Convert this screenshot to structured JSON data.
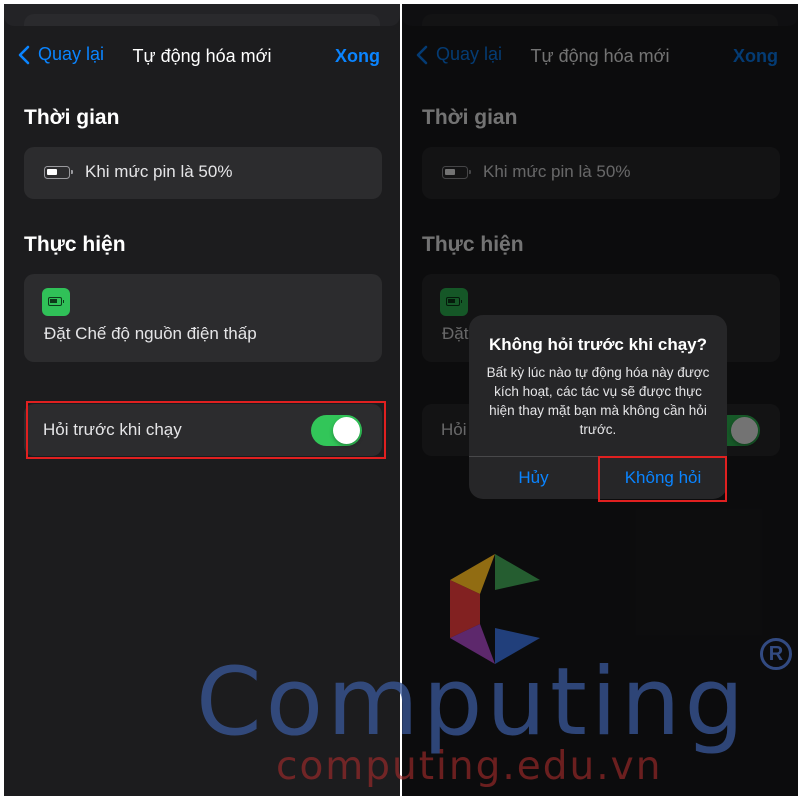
{
  "navbar": {
    "back_label": "Quay lại",
    "title": "Tự động hóa mới",
    "done_label": "Xong"
  },
  "time_section": {
    "header": "Thời gian",
    "trigger_text": "Khi mức pin là 50%",
    "icon": "battery-icon"
  },
  "action_section": {
    "header": "Thực hiện",
    "action_text": "Đặt Chế độ nguồn điện thấp",
    "icon": "battery-app-icon"
  },
  "ask_before_run": {
    "label": "Hỏi trước khi chạy",
    "enabled": true
  },
  "alert": {
    "title": "Không hỏi trước khi chạy?",
    "message": "Bất kỳ lúc nào tự động hóa này được kích hoạt, các tác vụ sẽ được thực hiện thay mặt bạn mà không cần hỏi trước.",
    "cancel_label": "Hủy",
    "confirm_label": "Không hỏi"
  },
  "watermark": {
    "brand": "Computing",
    "url": "computing.edu.vn",
    "registered_mark": "R"
  },
  "colors": {
    "accent": "#0a84ff",
    "toggle_on": "#32c659",
    "highlight": "#e02020",
    "background": "#1c1c1e",
    "card": "#2c2c2e"
  }
}
